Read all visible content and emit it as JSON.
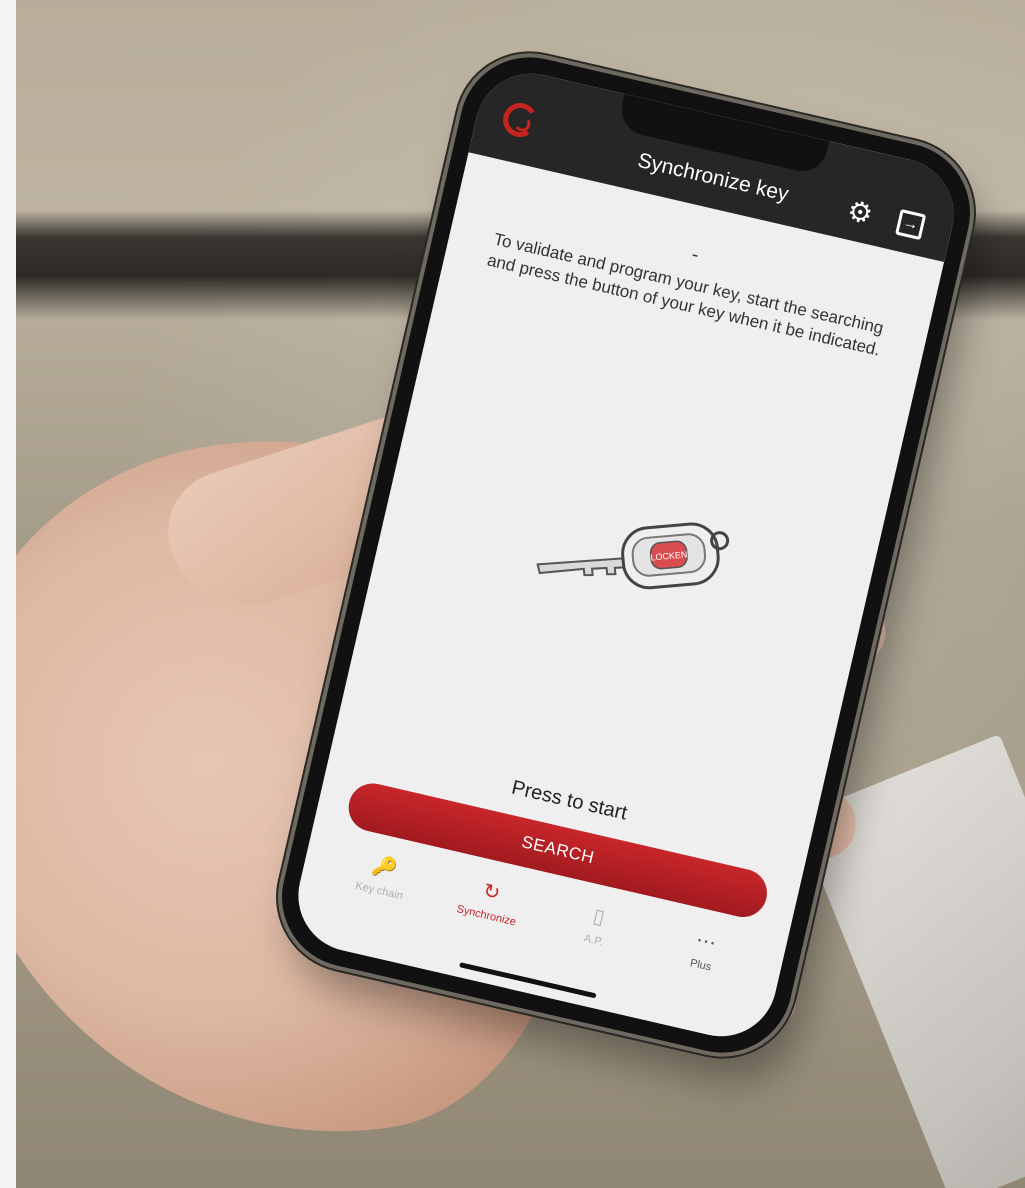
{
  "app": {
    "title": "Synchronize key",
    "status_text": "-",
    "instructions": "To validate and program your key, start the searching and press the button of your key when it be indicated.",
    "key_brand": "LOCKEN",
    "press_prompt": "Press to start",
    "search_label": "SEARCH",
    "accent_color": "#c8262a",
    "header_color": "#262626"
  },
  "header_icons": [
    "locken-logo-icon",
    "gear-icon",
    "logout-icon"
  ],
  "tabs": [
    {
      "label": "Key chain",
      "icon": "key-chain-icon",
      "active": false
    },
    {
      "label": "Synchronize",
      "icon": "sync-icon",
      "active": true
    },
    {
      "label": "A.P.",
      "icon": "door-icon",
      "active": false
    },
    {
      "label": "Plus",
      "icon": "more-icon",
      "active": false
    }
  ]
}
